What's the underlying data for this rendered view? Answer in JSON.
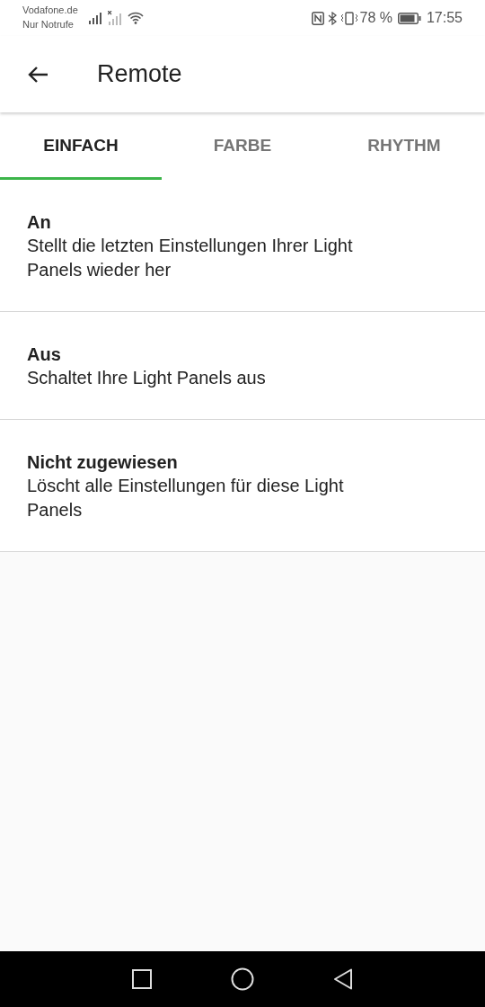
{
  "status_bar": {
    "carrier": "Vodafone.de",
    "network_note": "Nur Notrufe",
    "battery": "78 %",
    "time": "17:55"
  },
  "app_bar": {
    "title": "Remote"
  },
  "tabs": [
    {
      "label": "EINFACH",
      "selected": true
    },
    {
      "label": "FARBE",
      "selected": false
    },
    {
      "label": "RHYTHM",
      "selected": false
    }
  ],
  "options": [
    {
      "title": "An",
      "description": "Stellt die letzten Einstellungen Ihrer Light Panels wieder her"
    },
    {
      "title": "Aus",
      "description": "Schaltet Ihre Light Panels aus"
    },
    {
      "title": "Nicht zugewiesen",
      "description": "Löscht alle Einstellungen für diese Light Panels"
    }
  ]
}
